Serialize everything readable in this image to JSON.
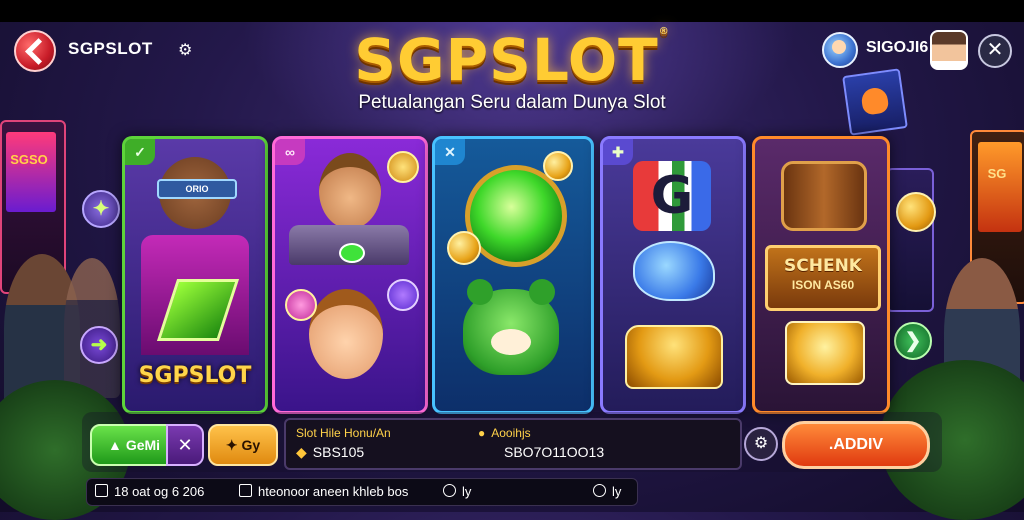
{
  "header": {
    "brand_small": "SGPSLOT",
    "title": "SGPSLOT",
    "subtitle": "Petualangan Seru dalam Dunya Slot",
    "username": "SIGOJI6"
  },
  "machines": {
    "left_screen": "SGSO",
    "right_screen": "SG"
  },
  "cards": {
    "card1_band": "ORIO",
    "card1_label": "SGPSLOT",
    "card4_logo": "G",
    "card5_line1": "SCHENK",
    "card5_line2": "ISON AS60"
  },
  "controls": {
    "game_button": "GeMi",
    "orange_button": "Gy",
    "info_left_label": "Slot Hile Honu/An",
    "info_left_value": "SBS105",
    "info_right_label": "Aooihjs",
    "info_right_value": "SBO7O11OO13",
    "cta_button": ".ADDIV"
  },
  "footer": {
    "item1": "18 oat og 6 206",
    "item2": "hteonoor aneen khleb bos",
    "item3": "ly",
    "item4": "ly"
  },
  "icons": {
    "logo": "logo-badge-icon",
    "gear": "gear-icon",
    "user": "user-icon",
    "close": "close-icon",
    "left_arrow": "arrow-left-icon",
    "right_arrow": "arrow-right-icon",
    "settings": "settings-icon"
  },
  "colors": {
    "title_gold": "#ffcc33",
    "cta_orange": "#ff8a3a",
    "game_green": "#6ae24a",
    "card1_border": "#5dd43a",
    "card2_border": "#ff6ad8",
    "card3_border": "#48c2ff",
    "card4_border": "#8a7aff",
    "card5_border": "#ff8a2a"
  }
}
